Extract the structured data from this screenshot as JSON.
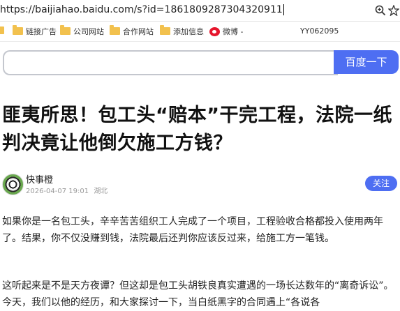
{
  "browser": {
    "url": "https://baijiahao.baidu.com/s?id=1861809287304320911",
    "bookmarks": [
      {
        "label": "链接广告"
      },
      {
        "label": "公司网站"
      },
      {
        "label": "合作网站"
      },
      {
        "label": "添加信息"
      },
      {
        "label": "微博 -"
      }
    ],
    "toolbar_text": "YY062095"
  },
  "search": {
    "input_value": "",
    "button_label": "百度一下"
  },
  "article": {
    "title": "匪夷所思！包工头“赔本”干完工程，法院一纸判决竟让他倒欠施工方钱？",
    "author": "快事橙",
    "date": "2026-04-07 19:01",
    "location": "湖北",
    "follow_label": "关注",
    "paragraphs": [
      "如果你是一名包工头，辛辛苦苦组织工人完成了一个项目，工程验收合格都投入使用两年了。结果，你不仅没赚到钱，法院最后还判你应该反过来，给施工方一笔钱。",
      "这听起来是不是天方夜谭？但这却是包工头胡铁良真实遭遇的一场长达数年的“离奇诉讼”。今天，我们以他的经历，和大家探讨一下，当白纸黑字的合同遇上“各说各"
    ]
  }
}
